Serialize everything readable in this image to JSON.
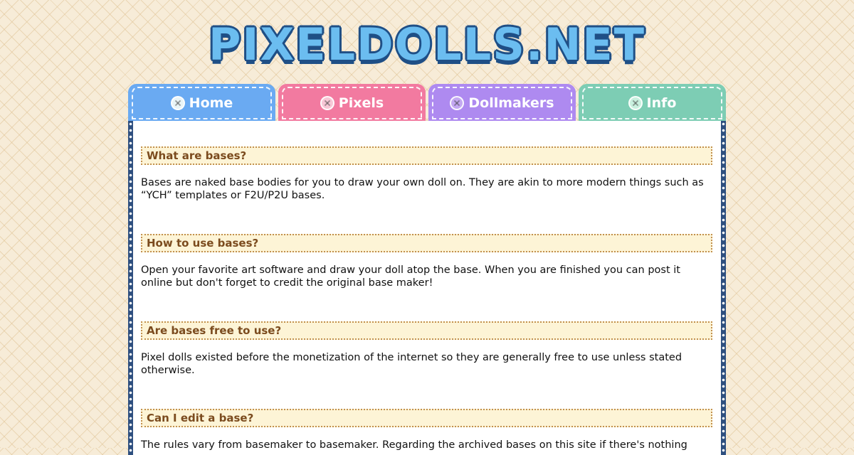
{
  "site": {
    "logo_text": "PIXELDOLLS.NET"
  },
  "nav": {
    "tabs": [
      {
        "label": "Home",
        "color": "#6aaaf2"
      },
      {
        "label": "Pixels",
        "color": "#f27aa0"
      },
      {
        "label": "Dollmakers",
        "color": "#ae8af0"
      },
      {
        "label": "Info",
        "color": "#7dcdb4"
      }
    ]
  },
  "sections": [
    {
      "heading": "What are bases?",
      "text": "Bases are naked base bodies for you to draw your own doll on. They are akin to more modern things such as “YCH” templates or F2U/P2U bases."
    },
    {
      "heading": "How to use bases?",
      "text": "Open your favorite art software and draw your doll atop the base. When you are finished you can post it online but don't forget to credit the original base maker!"
    },
    {
      "heading": "Are bases free to use?",
      "text": "Pixel dolls existed before the monetization of the internet so they are generally free to use unless stated otherwise."
    },
    {
      "heading": "Can I edit a base?",
      "text": "The rules vary from basemaker to basemaker. Regarding the archived bases on this site if there's nothing"
    }
  ]
}
